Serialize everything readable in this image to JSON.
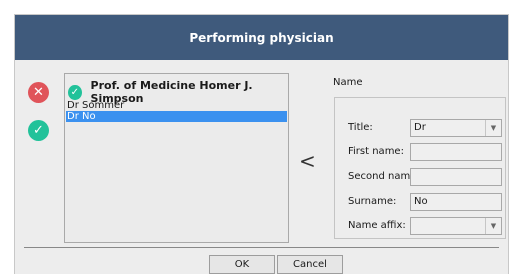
{
  "dialog": {
    "title": "Performing physician",
    "remove_icon": "close-icon",
    "confirm_icon": "check-icon",
    "move_icon": "chevron-left-icon"
  },
  "list": {
    "selected": "Prof. of Medicine Homer J. Simpson",
    "items": [
      {
        "label": "Dr Sommer",
        "selected": false
      },
      {
        "label": "Dr No",
        "selected": true
      }
    ]
  },
  "name_panel": {
    "group_label": "Name",
    "title_label": "Title:",
    "title_value": "Dr",
    "first_name_label": "First name:",
    "first_name_value": "",
    "second_name_label": "Second name:",
    "second_name_value": "",
    "surname_label": "Surname:",
    "surname_value": "No",
    "name_affix_label": "Name affix:",
    "name_affix_value": ""
  },
  "buttons": {
    "ok": "OK",
    "cancel": "Cancel"
  },
  "colors": {
    "title_bar": "#3f5a7c",
    "remove": "#e0545a",
    "confirm": "#22c29a",
    "selection": "#3b91ef"
  }
}
